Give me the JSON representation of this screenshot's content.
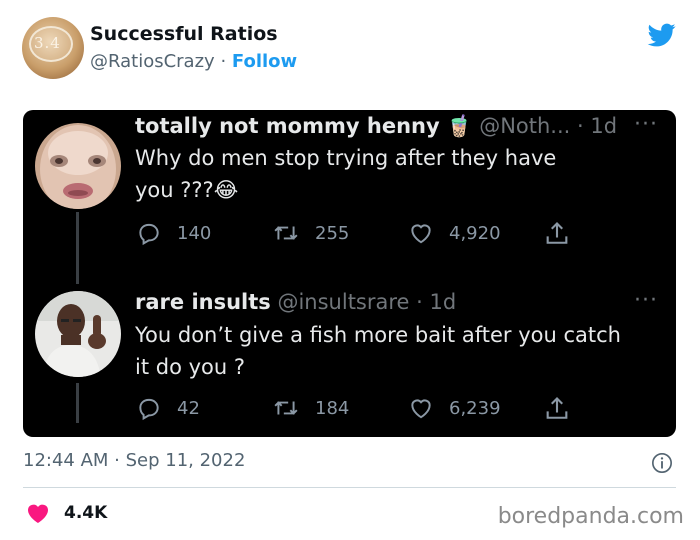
{
  "account": {
    "name": "Successful Ratios",
    "handle": "@RatiosCrazy",
    "separator": "·",
    "follow_label": "Follow",
    "avatar_text": "3.4"
  },
  "quoted_thread": [
    {
      "display_name": "totally not mommy henny",
      "emoji": "🧋",
      "handle": "@Noth...",
      "time": "· 1d",
      "more": "···",
      "text_line1": "Why do men stop trying after they have",
      "text_line2": "you  ???",
      "text_emoji": "😂",
      "replies": "140",
      "retweets": "255",
      "likes": "4,920"
    },
    {
      "display_name": "rare insults",
      "handle": "@insultsrare",
      "time": "· 1d",
      "more": "···",
      "text_line1": "You don’t give a fish more bait after you catch",
      "text_line2": "it do you ?",
      "replies": "42",
      "retweets": "184",
      "likes": "6,239"
    }
  ],
  "footer": {
    "timestamp": "12:44 AM · Sep 11, 2022",
    "like_count": "4.4K",
    "watermark": "boredpanda.com"
  },
  "colors": {
    "twitter_blue": "#1d9bf0",
    "like_pink": "#f91880",
    "card_bg": "#000000"
  },
  "icons": [
    "twitter-bird-icon",
    "reply-icon",
    "retweet-icon",
    "like-icon",
    "share-icon",
    "info-icon",
    "heart-icon"
  ]
}
